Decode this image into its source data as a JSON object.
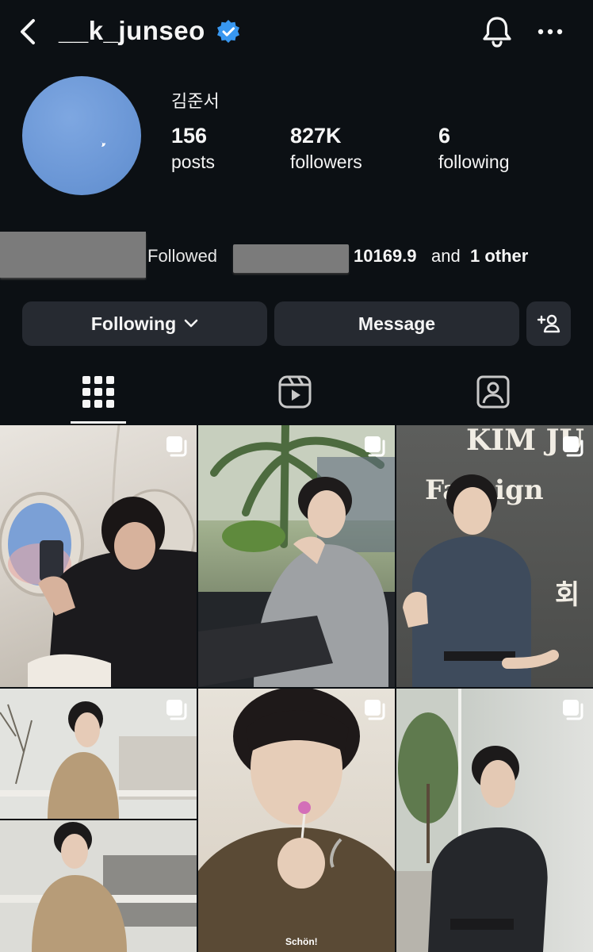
{
  "header": {
    "username": "__k_junseo",
    "back_icon": "chevron-left-icon",
    "verified_icon": "verified-badge-icon",
    "bell_icon": "bell-icon",
    "more_icon": "more-horizontal-icon"
  },
  "profile": {
    "real_name": "김준서",
    "stats": [
      {
        "value": "156",
        "label": "posts"
      },
      {
        "value": "827K",
        "label": "followers"
      },
      {
        "value": "6",
        "label": "following"
      }
    ],
    "mutual": {
      "prefix": "Followed",
      "name": "10169.9",
      "and": "and",
      "other": "1 other"
    }
  },
  "actions": {
    "following_label": "Following",
    "message_label": "Message"
  },
  "tabs": [
    "grid-icon",
    "reels-icon",
    "tagged-icon"
  ],
  "posts": [
    {
      "id": "post-1"
    },
    {
      "id": "post-2"
    },
    {
      "id": "post-3",
      "overlay_lines": [
        "KIM JU",
        "Fansign",
        "회"
      ]
    },
    {
      "id": "post-4"
    },
    {
      "id": "post-5",
      "overlay_brand": "Schön!"
    },
    {
      "id": "post-6"
    }
  ],
  "colors": {
    "background": "#0c1014",
    "button": "#262a31",
    "verified": "#3897f0"
  }
}
